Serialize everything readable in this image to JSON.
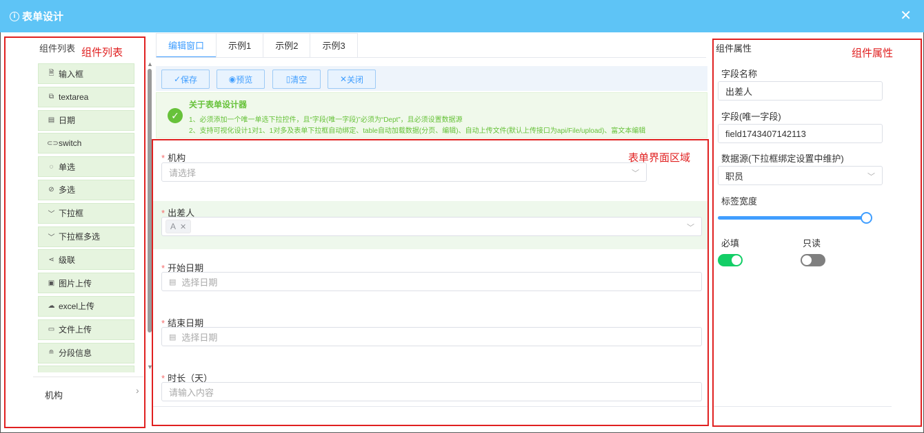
{
  "window": {
    "title": "表单设计",
    "title_icon": "info-circle-icon",
    "close_icon": "close-icon"
  },
  "left": {
    "title": "组件列表",
    "items": [
      {
        "label": "输入框",
        "icon": "file-icon"
      },
      {
        "label": "textarea",
        "icon": "copy-icon"
      },
      {
        "label": "日期",
        "icon": "calendar-icon"
      },
      {
        "label": "switch",
        "icon": "toggle-icon"
      },
      {
        "label": "单选",
        "icon": "radio-icon"
      },
      {
        "label": "多选",
        "icon": "circle-check-icon"
      },
      {
        "label": "下拉框",
        "icon": "chevron-down-icon"
      },
      {
        "label": "下拉框多选",
        "icon": "chevron-down-icon"
      },
      {
        "label": "级联",
        "icon": "share-icon"
      },
      {
        "label": "图片上传",
        "icon": "picture-icon"
      },
      {
        "label": "excel上传",
        "icon": "cloud-upload-icon"
      },
      {
        "label": "文件上传",
        "icon": "folder-icon"
      },
      {
        "label": "分段信息",
        "icon": "divider-icon"
      }
    ],
    "footer_label": "机构"
  },
  "center": {
    "tabs": [
      "编辑窗口",
      "示例1",
      "示例2",
      "示例3"
    ],
    "active_tab": 0,
    "toolbar": {
      "save": "保存",
      "preview": "预览",
      "clear": "清空",
      "close": "关闭"
    },
    "notice": {
      "title": "关于表单设计器",
      "line1": "1、必须添加一个唯一单选下拉控件，且“字段(唯一字段)”必须为“Dept”，且必须设置数据源",
      "line2": "2、支持可视化设计1对1、1对多及表单下拉框自动绑定、table自动加载数据(分页、编辑)、自动上传文件(默认上传接口为api/File/upload)、富文本编辑"
    },
    "fields": [
      {
        "label": "机构",
        "placeholder": "请选择",
        "type": "select",
        "required": "*"
      },
      {
        "label": "出差人",
        "tag": "A",
        "type": "multi-select",
        "required": "*"
      },
      {
        "label": "开始日期",
        "placeholder": "选择日期",
        "type": "date",
        "required": "*"
      },
      {
        "label": "结束日期",
        "placeholder": "选择日期",
        "type": "date",
        "required": "*"
      },
      {
        "label": "时长（天）",
        "placeholder": "请输入内容",
        "type": "input",
        "required": "*"
      }
    ]
  },
  "right": {
    "title": "组件属性",
    "field_name_label": "字段名称",
    "field_name_value": "出差人",
    "field_key_label": "字段(唯一字段)",
    "field_key_value": "field1743407142113",
    "datasource_label": "数据源(下拉框绑定设置中维护)",
    "datasource_value": "职员",
    "label_width_label": "标签宽度",
    "label_width_value": 1.0,
    "required_label": "必填",
    "required_on": true,
    "readonly_label": "只读",
    "readonly_on": false
  },
  "annotations": {
    "left": "组件列表",
    "center": "表单界面区域",
    "right": "组件属性"
  },
  "colors": {
    "titlebar": "#5ec4f6",
    "accent": "#409eff",
    "success": "#67c23a",
    "toggle_on": "#13ce66",
    "toggle_off": "#7f7f7f",
    "annotation": "#e02020"
  }
}
